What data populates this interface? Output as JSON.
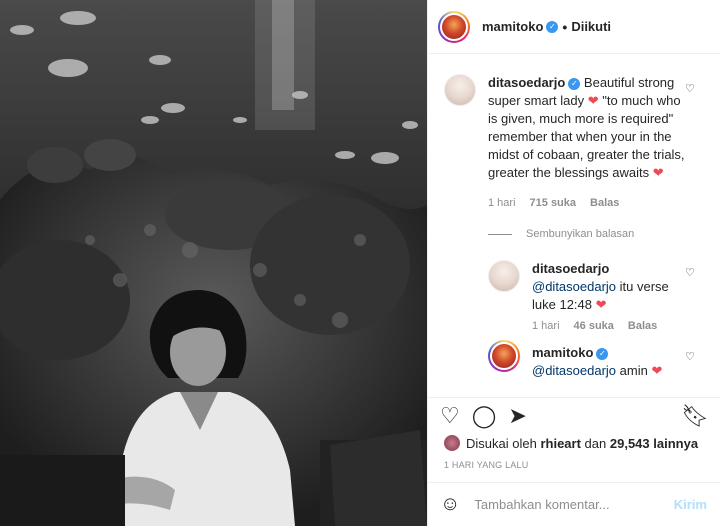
{
  "header": {
    "username": "mamitoko",
    "follow_status": "Diikuti"
  },
  "comments": [
    {
      "username": "ditasoedarjo",
      "text_before_heart1": "Beautiful strong super smart lady",
      "text_mid": "\"to much who is given, much more is required\" remember that when your in the midst of cobaan, greater the trials, greater the blessings awaits",
      "time": "1 hari",
      "likes": "715 suka",
      "reply": "Balas"
    }
  ],
  "hide_replies": "Sembunyikan balasan",
  "replies": [
    {
      "username": "ditasoedarjo",
      "mention": "@ditasoedarjo",
      "text": "itu verse luke 12:48",
      "time": "1 hari",
      "likes": "46 suka",
      "reply": "Balas"
    },
    {
      "username": "mamitoko",
      "mention": "@ditasoedarjo",
      "text": "amin"
    }
  ],
  "likes_line": {
    "prefix": "Disukai oleh",
    "user": "rhieart",
    "middle": "dan",
    "count": "29,543 lainnya"
  },
  "post_time": "1 HARI YANG LALU",
  "comment_box": {
    "placeholder": "Tambahkan komentar...",
    "send": "Kirim"
  },
  "colors": {
    "verified": "#3897f0",
    "heart": "#ed4956",
    "link": "#00376b",
    "send_disabled": "#b2dffc"
  }
}
